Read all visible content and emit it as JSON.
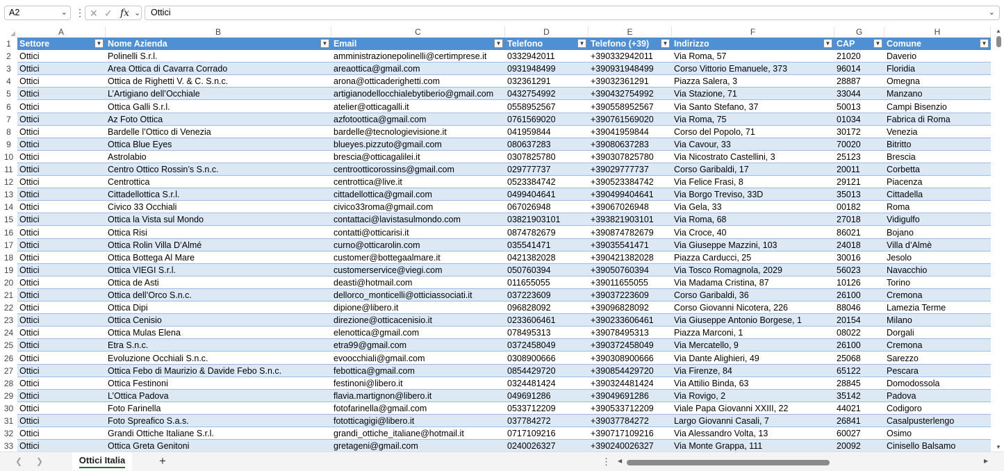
{
  "formula_bar": {
    "name_box": "A2",
    "formula_value": "Ottici"
  },
  "columns": [
    "A",
    "B",
    "C",
    "D",
    "E",
    "F",
    "G",
    "H"
  ],
  "header": [
    "Settore",
    "Nome Azienda",
    "Email",
    "Telefono",
    "Telefono (+39)",
    "Indirizzo",
    "CAP",
    "Comune"
  ],
  "rows": [
    [
      "Ottici",
      "Polinelli S.r.l.",
      "amministrazionepolinelli@certimprese.it",
      "0332942011",
      "+390332942011",
      "Via Roma, 57",
      "21020",
      "Daverio"
    ],
    [
      "Ottici",
      "Area Ottica di Cavarra Corrado",
      "areaottica@gmail.com",
      "0931948499",
      "+390931948499",
      "Corso Vittorio Emanuele, 373",
      "96014",
      "Floridia"
    ],
    [
      "Ottici",
      "Ottica de Righetti V. & C. S.n.c.",
      "arona@otticaderighetti.com",
      "032361291",
      "+39032361291",
      "Piazza Salera, 3",
      "28887",
      "Omegna"
    ],
    [
      "Ottici",
      "L’Artigiano dell’Occhiale",
      "artigianodellocchialebytiberio@gmail.com",
      "0432754992",
      "+390432754992",
      "Via Stazione, 71",
      "33044",
      "Manzano"
    ],
    [
      "Ottici",
      "Ottica Galli S.r.l.",
      "atelier@otticagalli.it",
      "0558952567",
      "+390558952567",
      "Via Santo Stefano, 37",
      "50013",
      "Campi Bisenzio"
    ],
    [
      "Ottici",
      "Az Foto Ottica",
      "azfotoottica@gmail.com",
      "0761569020",
      "+390761569020",
      "Via Roma, 75",
      "01034",
      "Fabrica di Roma"
    ],
    [
      "Ottici",
      "Bardelle l’Ottico di Venezia",
      "bardelle@tecnologievisione.it",
      "041959844",
      "+39041959844",
      "Corso del Popolo, 71",
      "30172",
      "Venezia"
    ],
    [
      "Ottici",
      "Ottica Blue Eyes",
      "blueyes.pizzuto@gmail.com",
      "080637283",
      "+39080637283",
      "Via Cavour, 33",
      "70020",
      "Bitritto"
    ],
    [
      "Ottici",
      "Astrolabio",
      "brescia@otticagalilei.it",
      "0307825780",
      "+390307825780",
      "Via Nicostrato Castellini, 3",
      "25123",
      "Brescia"
    ],
    [
      "Ottici",
      "Centro Ottico Rossin’s S.n.c.",
      "centrootticorossins@gmail.com",
      "029777737",
      "+39029777737",
      "Corso Garibaldi, 17",
      "20011",
      "Corbetta"
    ],
    [
      "Ottici",
      "Centrottica",
      "centrottica@live.it",
      "0523384742",
      "+390523384742",
      "Via Felice Frasi, 8",
      "29121",
      "Piacenza"
    ],
    [
      "Ottici",
      "Cittadellottica S.r.l.",
      "cittadellottica@gmail.com",
      "0499404641",
      "+390499404641",
      "Via Borgo Treviso, 33D",
      "35013",
      "Cittadella"
    ],
    [
      "Ottici",
      "Civico 33 Occhiali",
      "civico33roma@gmail.com",
      "067026948",
      "+39067026948",
      "Via Gela, 33",
      "00182",
      "Roma"
    ],
    [
      "Ottici",
      "Ottica la Vista sul Mondo",
      "contattaci@lavistasulmondo.com",
      "03821903101",
      "+393821903101",
      "Via Roma, 68",
      "27018",
      "Vidigulfo"
    ],
    [
      "Ottici",
      "Ottica Risi",
      "contatti@otticarisi.it",
      "0874782679",
      "+390874782679",
      "Via Croce, 40",
      "86021",
      "Bojano"
    ],
    [
      "Ottici",
      "Ottica Rolin Villa D’Almé",
      "curno@otticarolin.com",
      "035541471",
      "+39035541471",
      "Via Giuseppe Mazzini, 103",
      "24018",
      "Villa d’Almè"
    ],
    [
      "Ottici",
      "Ottica Bottega Al Mare",
      "customer@bottegaalmare.it",
      "0421382028",
      "+390421382028",
      "Piazza Carducci, 25",
      "30016",
      "Jesolo"
    ],
    [
      "Ottici",
      "Ottica VIEGI S.r.l.",
      "customerservice@viegi.com",
      "050760394",
      "+39050760394",
      "Via Tosco Romagnola, 2029",
      "56023",
      "Navacchio"
    ],
    [
      "Ottici",
      "Ottica de Asti",
      "deasti@hotmail.com",
      "011655055",
      "+39011655055",
      "Via Madama Cristina, 87",
      "10126",
      "Torino"
    ],
    [
      "Ottici",
      "Ottica dell’Orco S.n.c.",
      "dellorco_monticelli@otticiassociati.it",
      "037223609",
      "+39037223609",
      "Corso Garibaldi, 36",
      "26100",
      "Cremona"
    ],
    [
      "Ottici",
      "Ottica Dipi",
      "dipione@libero.it",
      "096828092",
      "+39096828092",
      "Corso Giovanni Nicotera, 226",
      "88046",
      "Lamezia Terme"
    ],
    [
      "Ottici",
      "Ottica Cenisio",
      "direzione@otticacenisio.it",
      "0233606461",
      "+390233606461",
      "Via Giuseppe Antonio Borgese, 1",
      "20154",
      "Milano"
    ],
    [
      "Ottici",
      "Ottica Mulas Elena",
      "elenottica@gmail.com",
      "078495313",
      "+39078495313",
      "Piazza Marconi, 1",
      "08022",
      "Dorgali"
    ],
    [
      "Ottici",
      "Etra S.n.c.",
      "etra99@gmail.com",
      "0372458049",
      "+390372458049",
      "Via Mercatello, 9",
      "26100",
      "Cremona"
    ],
    [
      "Ottici",
      "Evoluzione Occhiali S.n.c.",
      "evoocchiali@gmail.com",
      "0308900666",
      "+390308900666",
      "Via Dante Alighieri, 49",
      "25068",
      "Sarezzo"
    ],
    [
      "Ottici",
      "Ottica Febo di Maurizio & Davide Febo S.n.c.",
      "febottica@gmail.com",
      "0854429720",
      "+390854429720",
      "Via Firenze, 84",
      "65122",
      "Pescara"
    ],
    [
      "Ottici",
      "Ottica Festinoni",
      "festinoni@libero.it",
      "0324481424",
      "+390324481424",
      "Via Attilio Binda, 63",
      "28845",
      "Domodossola"
    ],
    [
      "Ottici",
      "L’Ottica Padova",
      "flavia.martignon@libero.it",
      "049691286",
      "+39049691286",
      "Via Rovigo, 2",
      "35142",
      "Padova"
    ],
    [
      "Ottici",
      "Foto Farinella",
      "fotofarinella@gmail.com",
      "0533712209",
      "+390533712209",
      "Viale Papa Giovanni XXIII, 22",
      "44021",
      "Codigoro"
    ],
    [
      "Ottici",
      "Foto Spreafico S.a.s.",
      "fototticagigi@libero.it",
      "037784272",
      "+39037784272",
      "Largo Giovanni Casali, 7",
      "26841",
      "Casalpusterlengo"
    ],
    [
      "Ottici",
      "Grandi Ottiche Italiane S.r.l.",
      "grandi_ottiche_italiane@hotmail.it",
      "0717109216",
      "+390717109216",
      "Via Alessandro Volta, 13",
      "60027",
      "Osimo"
    ],
    [
      "Ottici",
      "Ottica Greta Genitoni",
      "gretageni@gmail.com",
      "0240026327",
      "+390240026327",
      "Via Monte Grappa, 111",
      "20092",
      "Cinisello Balsamo"
    ]
  ],
  "sheet_tabs": [
    "Ottici Italia"
  ],
  "icons": {
    "cancel": "close-icon",
    "confirm": "check-icon",
    "function": "fx-icon",
    "add_sheet": "plus-icon"
  },
  "colors": {
    "header_fill": "#4f8fd3",
    "band_fill": "#dde8f5",
    "tab_accent": "#1e6f3c"
  }
}
